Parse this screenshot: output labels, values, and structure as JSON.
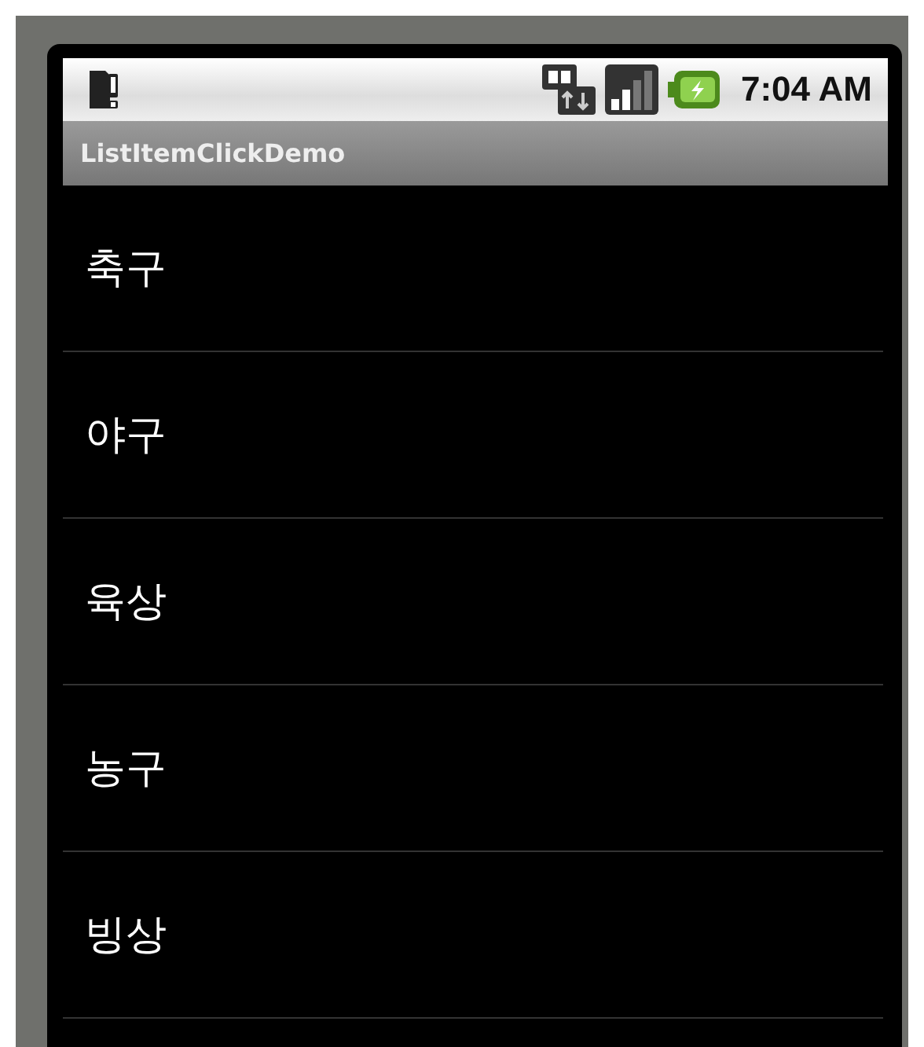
{
  "status_bar": {
    "time": "7:04 AM"
  },
  "title_bar": {
    "title": "ListItemClickDemo"
  },
  "list": {
    "items": [
      {
        "label": "축구"
      },
      {
        "label": "야구"
      },
      {
        "label": "육상"
      },
      {
        "label": "농구"
      },
      {
        "label": "빙상"
      }
    ]
  }
}
